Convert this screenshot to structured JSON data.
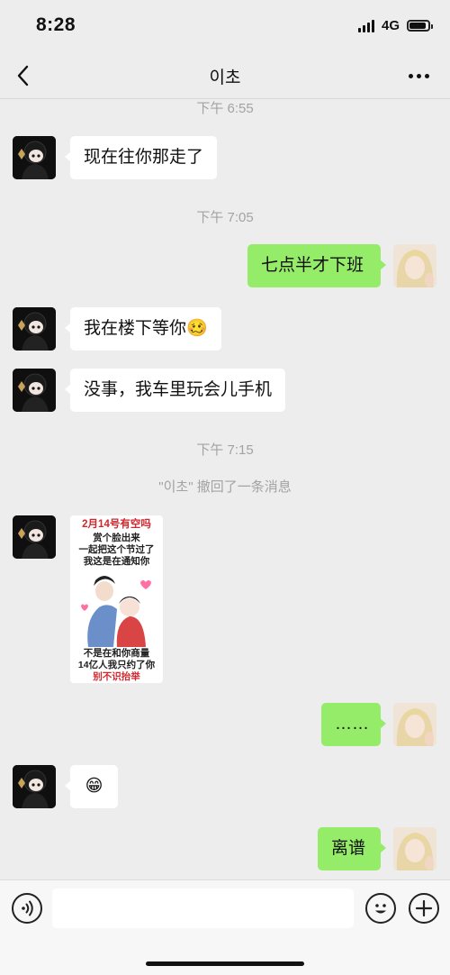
{
  "status_bar": {
    "time": "8:28",
    "network": "4G",
    "signal_bars": 4,
    "battery_level": 0.9
  },
  "header": {
    "title": "이초",
    "back_icon": "chevron-left-icon",
    "more_icon": "more-dots-icon"
  },
  "messages": {
    "time_1": "下午 6:55",
    "m1": "现在往你那走了",
    "time_2": "下午 7:05",
    "m2": "七点半才下班",
    "m3": "我在楼下等你🥴",
    "m4": "没事，我车里玩会儿手机",
    "time_3": "下午 7:15",
    "recall_notice": "\"이초\" 撤回了一条消息",
    "sticker": {
      "line1": "2月14号有空吗",
      "line2": "赏个脸出来",
      "line3": "一起把这个节过了",
      "line4": "我这是在通知你",
      "line5": "不是在和你商量",
      "line6": "14亿人我只约了你",
      "line7": "别不识抬举"
    },
    "m5": "……",
    "m6": "😁",
    "m7": "离谱"
  },
  "input_bar": {
    "voice_icon": "voice-icon",
    "emoji_icon": "emoji-icon",
    "plus_icon": "plus-icon",
    "placeholder": ""
  },
  "colors": {
    "background": "#ededed",
    "outgoing_bubble": "#95ec69",
    "incoming_bubble": "#ffffff",
    "timestamp": "#a3a3a3"
  }
}
